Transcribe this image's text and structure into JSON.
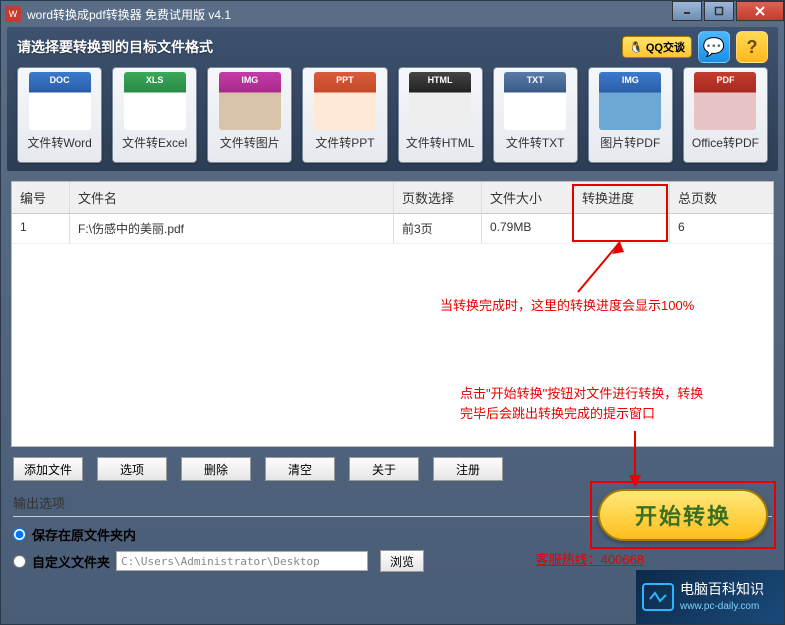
{
  "title": "word转换成pdf转换器 免费试用版 v4.1",
  "header": {
    "prompt": "请选择要转换到的目标文件格式",
    "qq_label": "QQ交谈"
  },
  "formats": [
    {
      "tag": "DOC",
      "label": "文件转Word"
    },
    {
      "tag": "XLS",
      "label": "文件转Excel"
    },
    {
      "tag": "IMG",
      "label": "文件转图片"
    },
    {
      "tag": "PPT",
      "label": "文件转PPT"
    },
    {
      "tag": "HTML",
      "label": "文件转HTML"
    },
    {
      "tag": "TXT",
      "label": "文件转TXT"
    },
    {
      "tag": "IMG",
      "label": "图片转PDF"
    },
    {
      "tag": "PDF",
      "label": "Office转PDF"
    }
  ],
  "columns": {
    "id": "编号",
    "name": "文件名",
    "page": "页数选择",
    "size": "文件大小",
    "prog": "转换进度",
    "total": "总页数"
  },
  "rows": [
    {
      "id": "1",
      "name": "F:\\伤感中的美丽.pdf",
      "page": "前3页",
      "size": "0.79MB",
      "prog": "",
      "total": "6"
    }
  ],
  "annotations": {
    "a1": "当转换完成时，这里的转换进度会显示100%",
    "a2": "点击\"开始转换\"按钮对文件进行转换，转换完毕后会跳出转换完成的提示窗口"
  },
  "buttons": {
    "add": "添加文件",
    "opt": "选项",
    "del": "删除",
    "clear": "清空",
    "about": "关于",
    "reg": "注册",
    "start": "开始转换",
    "browse": "浏览"
  },
  "output": {
    "section": "输出选项",
    "opt1": "保存在原文件夹内",
    "opt2": "自定义文件夹",
    "path": "C:\\Users\\Administrator\\Desktop"
  },
  "hotline": "客服热线：400668",
  "watermark": {
    "line1": "电脑百科知识",
    "line2": "www.pc-daily.com"
  }
}
